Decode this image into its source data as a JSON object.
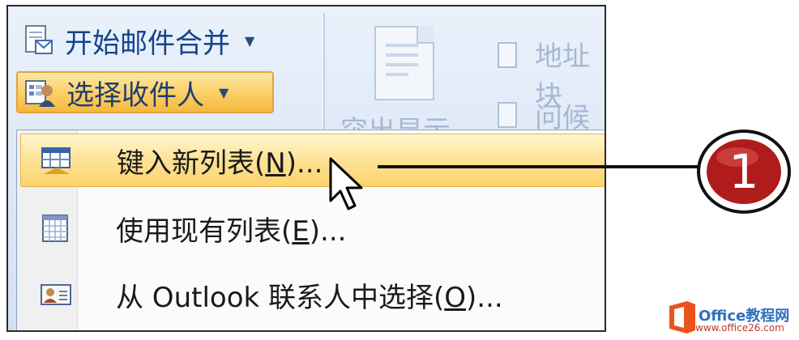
{
  "ribbon": {
    "start_mail_merge": "开始邮件合并",
    "select_recipients": "选择收件人",
    "ghost_address": "地址块",
    "ghost_greeting": "问候语",
    "ghost_highlight": "突出显示"
  },
  "menu": {
    "items": [
      {
        "label_main": "键入新列表(",
        "mnemonic": "N",
        "label_end": ")..."
      },
      {
        "label_main": "使用现有列表(",
        "mnemonic": "E",
        "label_end": ")..."
      },
      {
        "label_main": "从 Outlook 联系人中选择(",
        "mnemonic": "O",
        "label_end": ")..."
      }
    ]
  },
  "callout": {
    "number": "1"
  },
  "watermark": {
    "title": "Office教程网",
    "url": "www.office26.com"
  },
  "colors": {
    "accent": "#f6b93c",
    "badge": "#b01c1c",
    "ribbon_text": "#15428b"
  }
}
